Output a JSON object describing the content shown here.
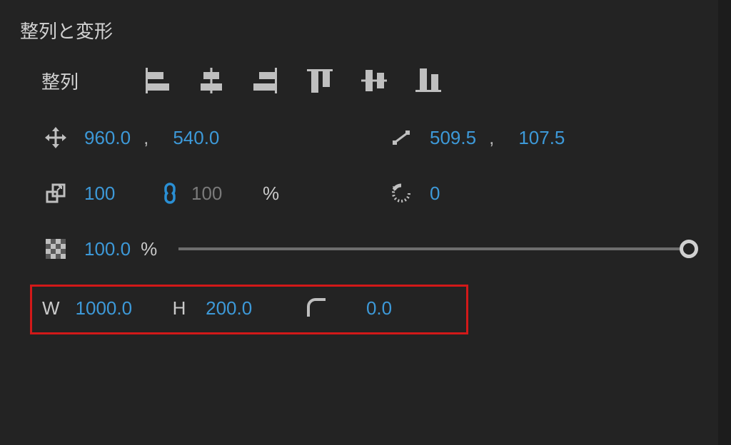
{
  "section": {
    "title": "整列と変形",
    "align_label": "整列"
  },
  "position": {
    "x": "960.0",
    "y": "540.0"
  },
  "anchor": {
    "x": "509.5",
    "y": "107.5"
  },
  "scale": {
    "x": "100",
    "y": "100",
    "unit": "%"
  },
  "rotation": {
    "value": "0"
  },
  "opacity": {
    "value": "100.0",
    "unit": "%"
  },
  "size": {
    "w_label": "W",
    "w": "1000.0",
    "h_label": "H",
    "h": "200.0",
    "corner": "0.0"
  }
}
